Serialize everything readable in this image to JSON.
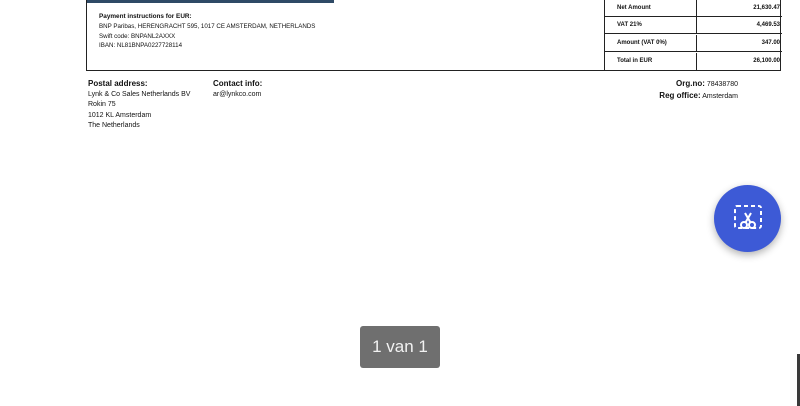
{
  "payment": {
    "title": "Payment instructions for EUR:",
    "bank": "BNP Paribas, HERENGRACHT 595, 1017 CE AMSTERDAM, NETHERLANDS",
    "swift": "Swift code: BNPANL2AXXX",
    "iban": "IBAN: NL81BNPA0227728114"
  },
  "totals": [
    {
      "label": "Net Amount",
      "value": "21,630.47"
    },
    {
      "label": "VAT 21%",
      "value": "4,469.53"
    },
    {
      "label": "Amount (VAT 0%)",
      "value": "347.00"
    },
    {
      "label": "Total in EUR",
      "value": "26,100.00"
    }
  ],
  "postal": {
    "heading": "Postal address:",
    "lines": [
      "Lynk & Co Sales Netherlands BV",
      "Rokin 75",
      "1012 KL Amsterdam",
      "The Netherlands"
    ]
  },
  "contact": {
    "heading": "Contact info:",
    "email": "ar@lynkco.com"
  },
  "registration": {
    "org_label": "Org.no:",
    "org_value": "78438780",
    "office_label": "Reg office:",
    "office_value": "Amsterdam"
  },
  "viewer": {
    "page_indicator": "1 van 1",
    "snip_icon": "scissors-selection-icon"
  },
  "colors": {
    "fab": "#3d5ad6",
    "header_bar": "#2f4a66",
    "badge": "#6f6f6f"
  }
}
